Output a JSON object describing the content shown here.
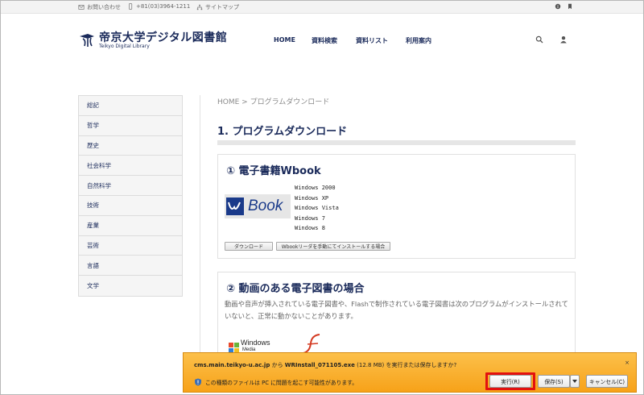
{
  "topbar": {
    "contact": "お問い合わせ",
    "phone": "+81(03)3964-1211",
    "sitemap": "サイトマップ"
  },
  "header": {
    "logo_jp": "帝京大学デジタル図書館",
    "logo_en": "Teikyo Digital Library",
    "nav": [
      "HOME",
      "資料検索",
      "資料リスト",
      "利用案内"
    ]
  },
  "sidebar": {
    "items": [
      "総記",
      "哲学",
      "歴史",
      "社会科学",
      "自然科学",
      "技術",
      "産業",
      "芸術",
      "言語",
      "文学"
    ]
  },
  "main": {
    "breadcrumb": "HOME > プログラムダウンロード",
    "title": "1.  プログラムダウンロード",
    "section1": {
      "title": "① 電子書籍Wbook",
      "logo_text": "Book",
      "os": [
        "Windows 2000",
        "Windows XP",
        "Windows Vista",
        "Windows 7",
        "Windows 8"
      ],
      "download_button": "ダウンロード",
      "manual_button": "Wbookリーダを手動にてインストールする場合"
    },
    "section2": {
      "title": "② 動画のある電子図書の場合",
      "description": "動画や音声が挿入されている電子図書や、Flashで制作されている電子図書は次のプログラムがインストールされていないと、正常に動かないことがあります。",
      "windows_media_label": "Windows",
      "windows_media_sub": "Media"
    }
  },
  "download_bar": {
    "host": "cms.main.teikyo-u.ac.jp",
    "from": " から ",
    "filename": "WRInstall_071105.exe",
    "size": " (12.8 MB) を実行または保存しますか?",
    "warning": "この種類のファイルは PC に問題を起こす可能性があります。",
    "run": "実行(R)",
    "save": "保存(S)",
    "cancel": "キャンセル(C)",
    "close": "×"
  },
  "colors": {
    "brand": "#1a2a5a",
    "download_bar": "#f7a219",
    "highlight": "#e3110f"
  }
}
